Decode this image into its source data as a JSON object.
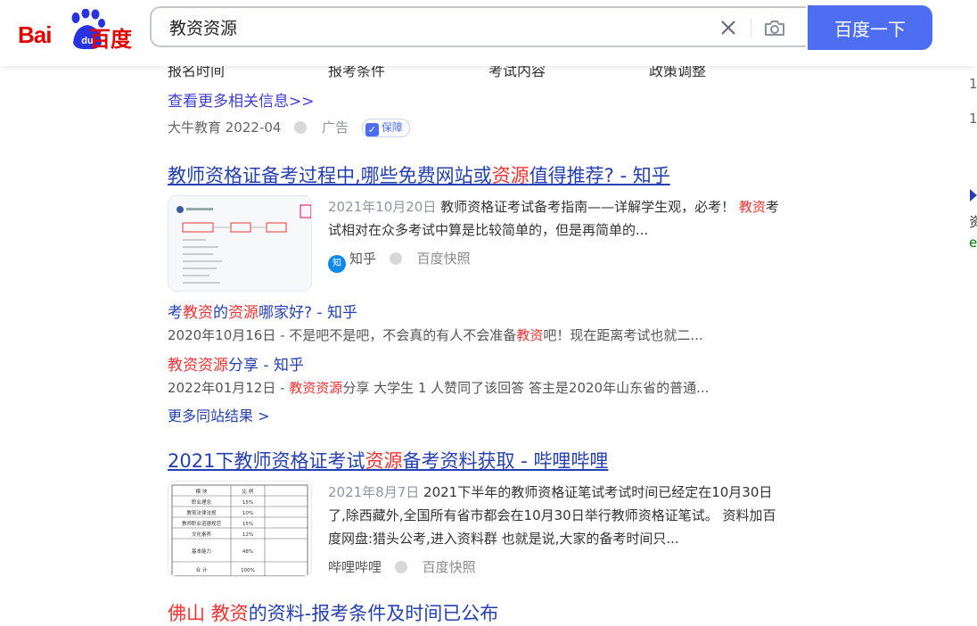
{
  "header": {
    "logo_text_bai": "Bai",
    "logo_text_baidu": "百度",
    "search_value": "教资资源",
    "search_button": "百度一下"
  },
  "ad": {
    "cut_cols": [
      "报名时间",
      "报考条件",
      "考试内容",
      "政策调整"
    ],
    "more_info": "查看更多相关信息>>",
    "source": "大牛教育 2022-04",
    "ad_label": "广告",
    "baozhang": "保障"
  },
  "result1": {
    "title_pre": "教师资格证备考过程中,哪些免费网站或",
    "title_hl": "资源",
    "title_post": "值得推荐? - 知乎",
    "date": "2021年10月20日",
    "abs_pre": " 教师资格证考试备考指南——详解学生观，必考！ ",
    "abs_hl": "教资",
    "abs_post": "考试相对在众多考试中算是比较简单的，但是再简单的...",
    "source": "知乎",
    "kuaizhao": "百度快照",
    "sub": [
      {
        "t1": "考",
        "t2": "教资",
        "t3": "的",
        "t4": "资源",
        "t5": "哪家好? - 知乎",
        "abs_pre": "2020年10月16日 - 不是吧不是吧，不会真的有人不会准备",
        "abs_hl": "教资",
        "abs_post": "吧！现在距离考试也就二..."
      },
      {
        "t1": "",
        "t2": "教资资源",
        "t3": "分享 - 知乎",
        "t4": "",
        "t5": "",
        "abs_pre": "2022年01月12日 - ",
        "abs_hl": "教资资源",
        "abs_post": "分享 大学生 1 人赞同了该回答 答主是2020年山东省的普通..."
      }
    ],
    "more_site": "更多同站结果 >"
  },
  "result2": {
    "title_pre": "2021下教师资格证考试",
    "title_hl": "资源",
    "title_post": "备考资料获取 - 哔哩哔哩",
    "date": "2021年8月7日",
    "abs": " 2021下半年的教师资格证笔试考试时间已经定在10月30日了,除西藏外,全国所有省市都会在10月30日举行教师资格证笔试。 资料加百度网盘:猎头公考,进入资料群 也就是说,大家的备考时间只...",
    "source": "哔哩哔哩",
    "kuaizhao": "百度快照",
    "thumb_table": {
      "headers": [
        "模 块",
        "比 例"
      ],
      "rows": [
        [
          "职业理念",
          "15%"
        ],
        [
          "教育法律法规",
          "10%"
        ],
        [
          "教师职业道德规范",
          "15%"
        ],
        [
          "文化素养",
          "12%"
        ],
        [
          "基本能力",
          "48%"
        ],
        [
          "合 计",
          "100%"
        ]
      ]
    }
  },
  "result3": {
    "title_pre": "佛山 ",
    "title_hl": "教资",
    "title_post": "的资料-报考条件及时间已公布"
  },
  "right_side": {
    "frag1": "1",
    "frag2": "1",
    "frag3": "资",
    "frag4": "e"
  }
}
